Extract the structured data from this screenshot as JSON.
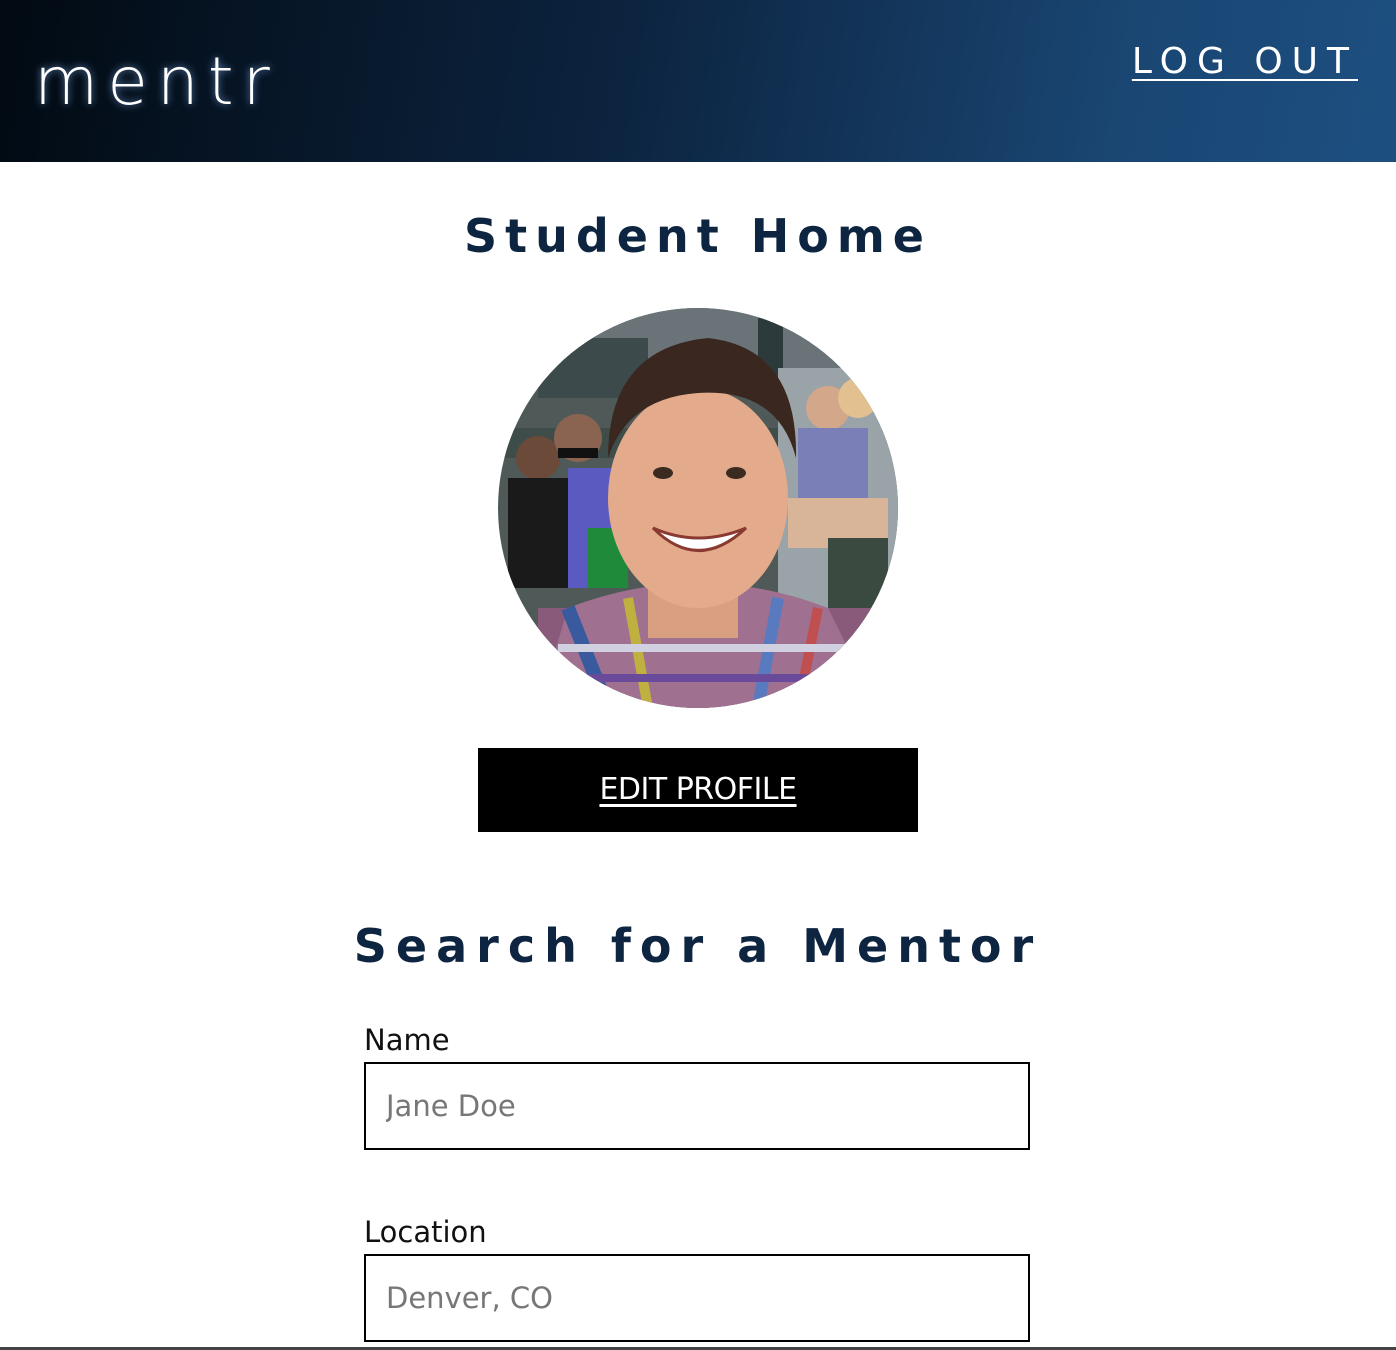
{
  "header": {
    "brand": "mentr",
    "logout_label": "LOG OUT"
  },
  "main": {
    "title": "Student Home",
    "edit_profile_label": "EDIT PROFILE"
  },
  "search": {
    "title": "Search for a Mentor",
    "fields": [
      {
        "label": "Name",
        "placeholder": "Jane Doe"
      },
      {
        "label": "Location",
        "placeholder": "Denver, CO"
      }
    ]
  },
  "colors": {
    "header_dark": "#020a12",
    "header_light": "#1c4f80",
    "heading": "#0d2540",
    "button_bg": "#000000"
  }
}
